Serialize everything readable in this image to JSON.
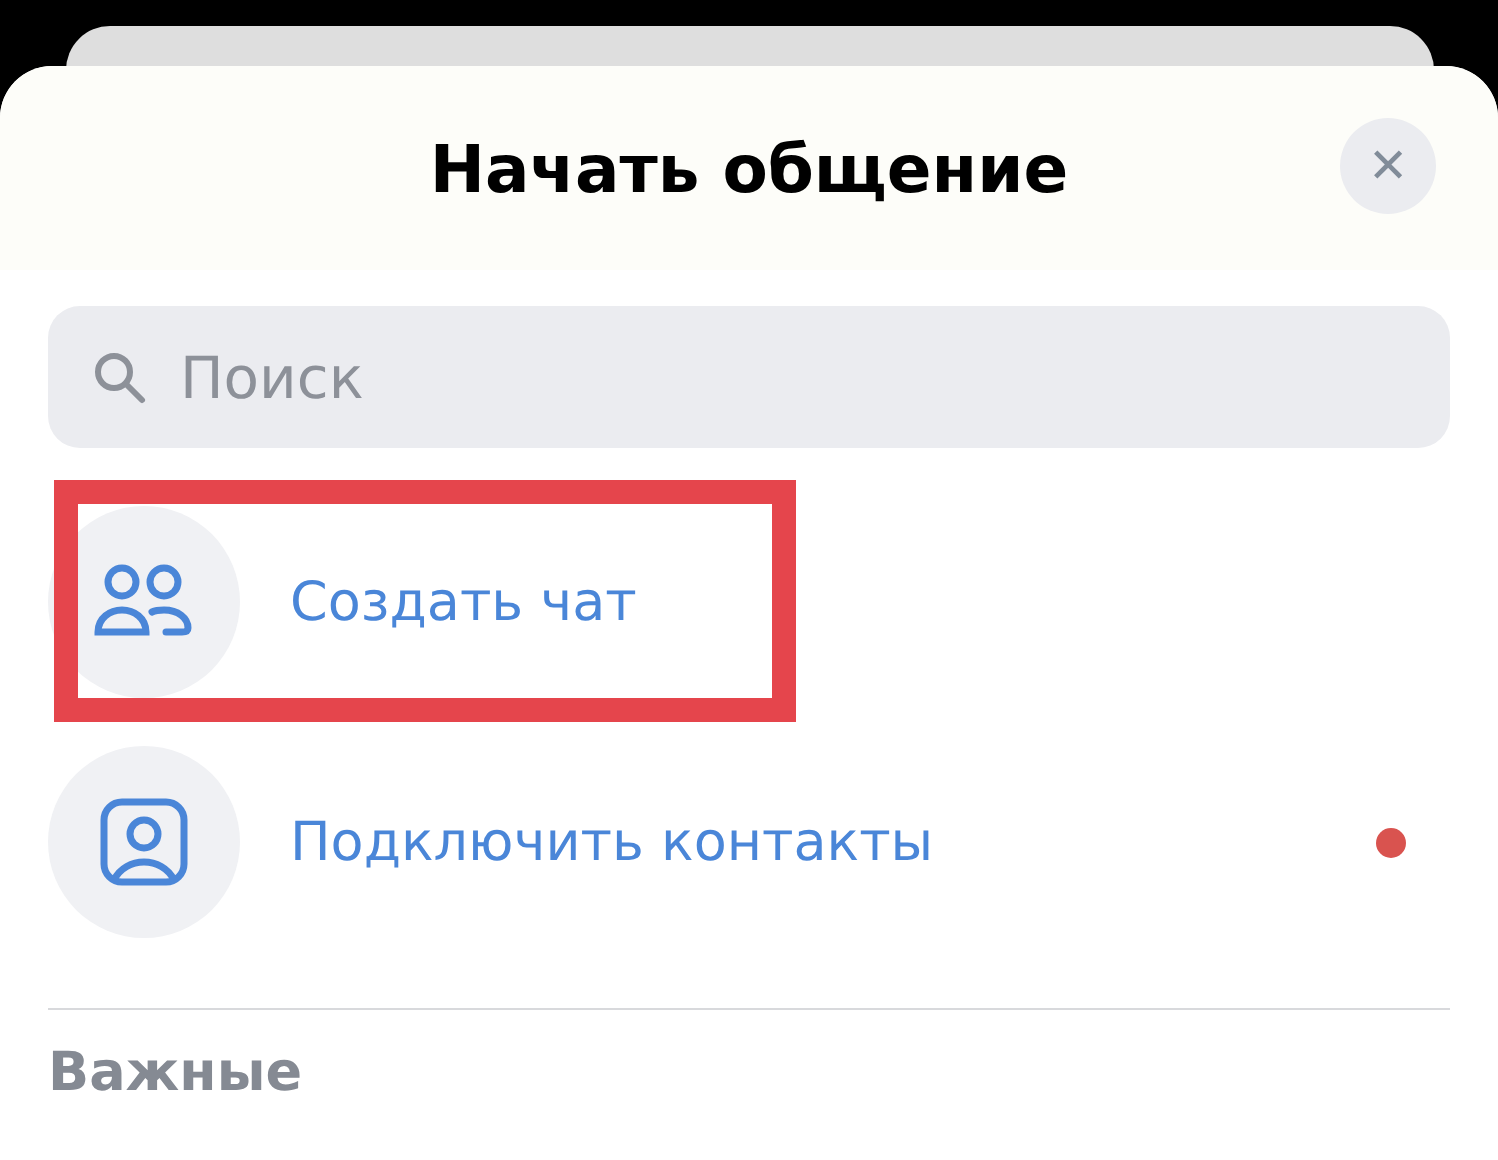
{
  "sheet": {
    "title": "Начать общение",
    "close_label": "✕"
  },
  "search": {
    "placeholder": "Поиск"
  },
  "actions": [
    {
      "kind": "group",
      "label": "Создать чат",
      "highlighted": true,
      "unread": false
    },
    {
      "kind": "contact",
      "label": "Подключить контакты",
      "highlighted": false,
      "unread": true
    }
  ],
  "section": {
    "title": "Важные"
  }
}
